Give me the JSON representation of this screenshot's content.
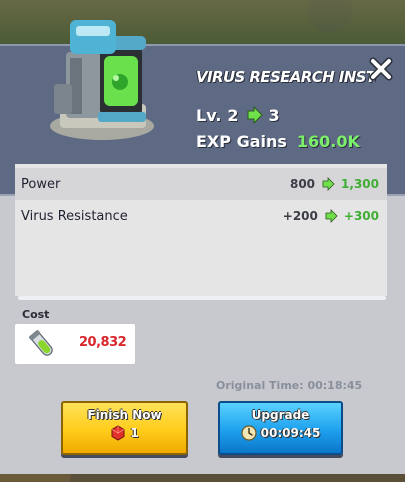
{
  "dialog": {
    "title": "VIRUS RESEARCH INSTITUTE I",
    "level_label": "Lv.",
    "level_from": "2",
    "level_to": "3",
    "exp_label": "EXP Gains",
    "exp_value": "160.0K"
  },
  "stats": [
    {
      "name": "Power",
      "from": "800",
      "to": "1,300"
    },
    {
      "name": "Virus Resistance",
      "from": "+200",
      "to": "+300"
    }
  ],
  "cost": {
    "label": "Cost",
    "amount": "20,832",
    "resource_icon": "serum-vial-icon"
  },
  "original_time": "Original Time: 00:18:45",
  "buttons": {
    "finish_label": "Finish Now",
    "finish_cost": "1",
    "finish_icon": "red-gem-icon",
    "upgrade_label": "Upgrade",
    "upgrade_time": "00:09:45",
    "upgrade_icon": "clock-icon"
  },
  "colors": {
    "exp": "#7df06b",
    "stat_increase": "#3fae34",
    "cost_amount": "#d9262c",
    "finish_button": "#ffcc1a",
    "upgrade_button": "#1ea0ee",
    "panel": "#5e6983"
  }
}
